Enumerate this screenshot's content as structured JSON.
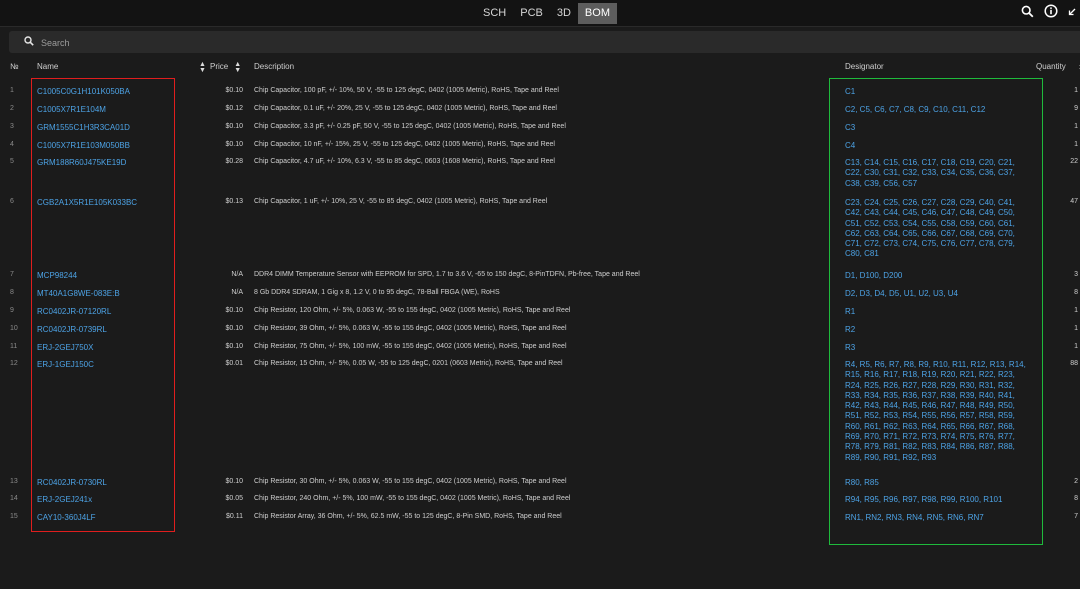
{
  "tabs": [
    {
      "label": "SCH",
      "active": false
    },
    {
      "label": "PCB",
      "active": false
    },
    {
      "label": "3D",
      "active": false
    },
    {
      "label": "BOM",
      "active": true
    }
  ],
  "icons": {
    "search": "search-icon",
    "info": "info-icon",
    "collapse": "collapse-icon"
  },
  "search": {
    "placeholder": "Search",
    "value": ""
  },
  "columns": {
    "num": "№",
    "name": "Name",
    "price": "Price",
    "description": "Description",
    "designator": "Designator",
    "quantity": "Quantity"
  },
  "highlight_colors": {
    "name_box": "#e01e1e",
    "designator_box": "#1fba3c",
    "link": "#4da3e6"
  },
  "rows": [
    {
      "num": "1",
      "name": "C1005C0G1H101K050BA",
      "price": "$0.10",
      "description": "Chip Capacitor, 100 pF, +/- 10%, 50 V, -55 to 125 degC, 0402 (1005 Metric), RoHS, Tape and Reel",
      "designator": "C1",
      "quantity": "1"
    },
    {
      "num": "2",
      "name": "C1005X7R1E104M",
      "price": "$0.12",
      "description": "Chip Capacitor, 0.1 uF, +/- 20%, 25 V, -55 to 125 degC, 0402 (1005 Metric), RoHS, Tape and Reel",
      "designator": "C2, C5, C6, C7, C8, C9, C10, C11, C12",
      "quantity": "9"
    },
    {
      "num": "3",
      "name": "GRM1555C1H3R3CA01D",
      "price": "$0.10",
      "description": "Chip Capacitor, 3.3 pF, +/- 0.25 pF, 50 V, -55 to 125 degC, 0402 (1005 Metric), RoHS, Tape and Reel",
      "designator": "C3",
      "quantity": "1"
    },
    {
      "num": "4",
      "name": "C1005X7R1E103M050BB",
      "price": "$0.10",
      "description": "Chip Capacitor, 10 nF, +/- 15%, 25 V, -55 to 125 degC, 0402 (1005 Metric), RoHS, Tape and Reel",
      "designator": "C4",
      "quantity": "1"
    },
    {
      "num": "5",
      "name": "GRM188R60J475KE19D",
      "price": "$0.28",
      "description": "Chip Capacitor, 4.7 uF, +/- 10%, 6.3 V, -55 to 85 degC, 0603 (1608 Metric), RoHS, Tape and Reel",
      "designator": "C13, C14, C15, C16, C17, C18, C19, C20, C21, C22, C30, C31, C32, C33, C34, C35, C36, C37, C38, C39, C56, C57",
      "quantity": "22"
    },
    {
      "num": "6",
      "name": "CGB2A1X5R1E105K033BC",
      "price": "$0.13",
      "description": "Chip Capacitor, 1 uF, +/- 10%, 25 V, -55 to 85 degC, 0402 (1005 Metric), RoHS, Tape and Reel",
      "designator": "C23, C24, C25, C26, C27, C28, C29, C40, C41, C42, C43, C44, C45, C46, C47, C48, C49, C50, C51, C52, C53, C54, C55, C58, C59, C60, C61, C62, C63, C64, C65, C66, C67, C68, C69, C70, C71, C72, C73, C74, C75, C76, C77, C78, C79, C80, C81",
      "quantity": "47"
    },
    {
      "num": "7",
      "name": "MCP98244",
      "price": "N/A",
      "description": "DDR4 DIMM Temperature Sensor with EEPROM for SPD, 1.7 to 3.6 V, -65 to 150 degC, 8-PinTDFN, Pb-free, Tape and Reel",
      "designator": "D1, D100, D200",
      "quantity": "3"
    },
    {
      "num": "8",
      "name": "MT40A1G8WE-083E:B",
      "price": "N/A",
      "description": "8 Gb DDR4 SDRAM, 1 Gig x 8, 1.2 V, 0 to 95 degC, 78-Ball FBGA (WE), RoHS",
      "designator": "D2, D3, D4, D5, U1, U2, U3, U4",
      "quantity": "8"
    },
    {
      "num": "9",
      "name": "RC0402JR-07120RL",
      "price": "$0.10",
      "description": "Chip Resistor, 120 Ohm, +/- 5%, 0.063 W, -55 to 155 degC, 0402 (1005 Metric), RoHS, Tape and Reel",
      "designator": "R1",
      "quantity": "1"
    },
    {
      "num": "10",
      "name": "RC0402JR-0739RL",
      "price": "$0.10",
      "description": "Chip Resistor, 39 Ohm, +/- 5%, 0.063 W, -55 to 155 degC, 0402 (1005 Metric), RoHS, Tape and Reel",
      "designator": "R2",
      "quantity": "1"
    },
    {
      "num": "11",
      "name": "ERJ-2GEJ750X",
      "price": "$0.10",
      "description": "Chip Resistor, 75 Ohm, +/- 5%, 100 mW, -55 to 155 degC, 0402 (1005 Metric), RoHS, Tape and Reel",
      "designator": "R3",
      "quantity": "1"
    },
    {
      "num": "12",
      "name": "ERJ-1GEJ150C",
      "price": "$0.01",
      "description": "Chip Resistor, 15 Ohm, +/- 5%, 0.05 W, -55 to 125 degC, 0201 (0603 Metric), RoHS, Tape and Reel",
      "designator": "R4, R5, R6, R7, R8, R9, R10, R11, R12, R13, R14, R15, R16, R17, R18, R19, R20, R21, R22, R23, R24, R25, R26, R27, R28, R29, R30, R31, R32, R33, R34, R35, R36, R37, R38, R39, R40, R41, R42, R43, R44, R45, R46, R47, R48, R49, R50, R51, R52, R53, R54, R55, R56, R57, R58, R59, R60, R61, R62, R63, R64, R65, R66, R67, R68, R69, R70, R71, R72, R73, R74, R75, R76, R77, R78, R79, R81, R82, R83, R84, R86, R87, R88, R89, R90, R91, R92, R93",
      "quantity": "88"
    },
    {
      "num": "13",
      "name": "RC0402JR-0730RL",
      "price": "$0.10",
      "description": "Chip Resistor, 30 Ohm, +/- 5%, 0.063 W, -55 to 155 degC, 0402 (1005 Metric), RoHS, Tape and Reel",
      "designator": "R80, R85",
      "quantity": "2"
    },
    {
      "num": "14",
      "name": "ERJ-2GEJ241x",
      "price": "$0.05",
      "description": "Chip Resistor, 240 Ohm, +/- 5%, 100 mW, -55 to 155 degC, 0402 (1005 Metric), RoHS, Tape and Reel",
      "designator": "R94, R95, R96, R97, R98, R99, R100, R101",
      "quantity": "8"
    },
    {
      "num": "15",
      "name": "CAY10-360J4LF",
      "price": "$0.11",
      "description": "Chip Resistor Array, 36 Ohm, +/- 5%, 62.5 mW, -55 to 125 degC, 8-Pin SMD, RoHS, Tape and Reel",
      "designator": "RN1, RN2, RN3, RN4, RN5, RN6, RN7",
      "quantity": "7"
    }
  ]
}
